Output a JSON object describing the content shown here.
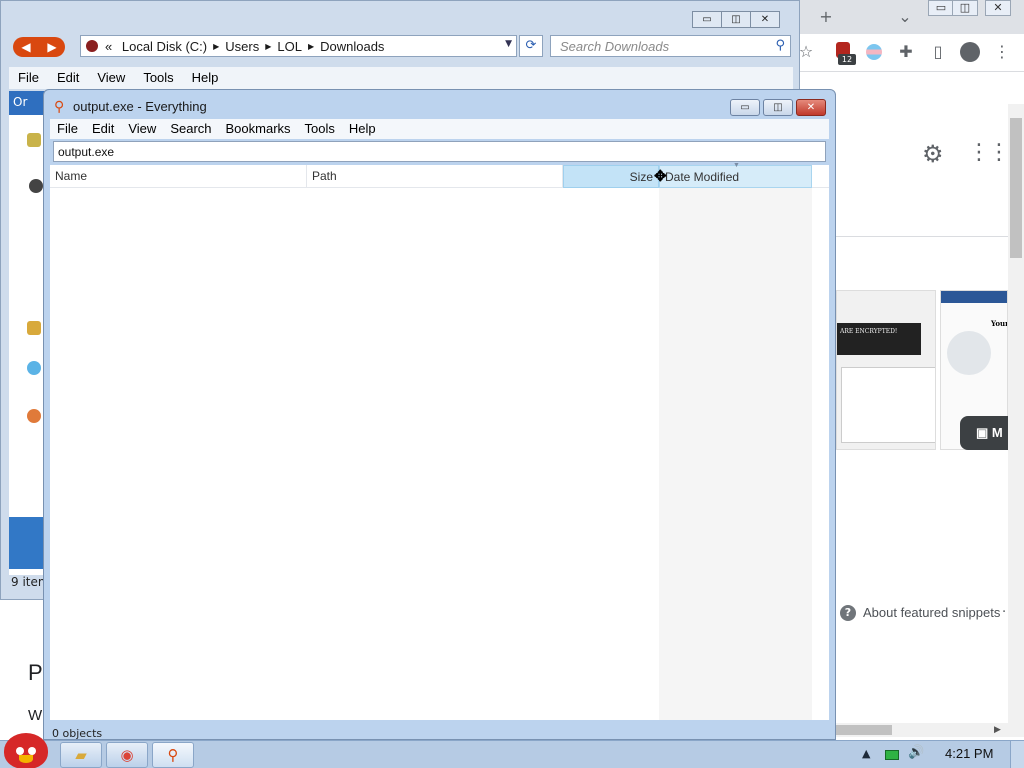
{
  "explorer": {
    "crumb_root": "«",
    "crumbs": [
      "Local Disk (C:)",
      "Users",
      "LOL",
      "Downloads"
    ],
    "search_placeholder": "Search Downloads",
    "menu": [
      "File",
      "Edit",
      "View",
      "Tools",
      "Help"
    ],
    "blueband_text": "Or",
    "status": "9 item",
    "controls": {
      "minimize": "▭",
      "maximize": "◫",
      "close": "✕"
    }
  },
  "everything": {
    "title": "output.exe - Everything",
    "menu": [
      "File",
      "Edit",
      "View",
      "Search",
      "Bookmarks",
      "Tools",
      "Help"
    ],
    "search_value": "output.exe",
    "columns": {
      "name": "Name",
      "path": "Path",
      "size": "Size",
      "date_modified": "Date Modified"
    },
    "sort_column": "date_modified",
    "status": "0 objects",
    "controls": {
      "minimize": "▭",
      "maximize": "◫",
      "close": "✕"
    }
  },
  "browser": {
    "new_tab": "+",
    "tab_menu": "⌄",
    "ext_badge": "12",
    "images_button": "M",
    "encrypted_banner": "ARE ENCRYPTED!",
    "thumb2_heading": "Your",
    "snippets_text": "About featured snippets",
    "snippets_dot": "·",
    "page_left_heading": "P",
    "page_left_text": "W",
    "gear_icon": "⚙",
    "apps_icon": "⋮⋮⋮"
  },
  "taskbar": {
    "clock": "4:21 PM",
    "tray_up": "▲",
    "tray_volume": "🔊"
  },
  "colors": {
    "titlebar": "#bcd3ee",
    "sort_column_header": "#c3e3f7",
    "close_button": "#c0392b",
    "start_bird": "#d62828"
  }
}
